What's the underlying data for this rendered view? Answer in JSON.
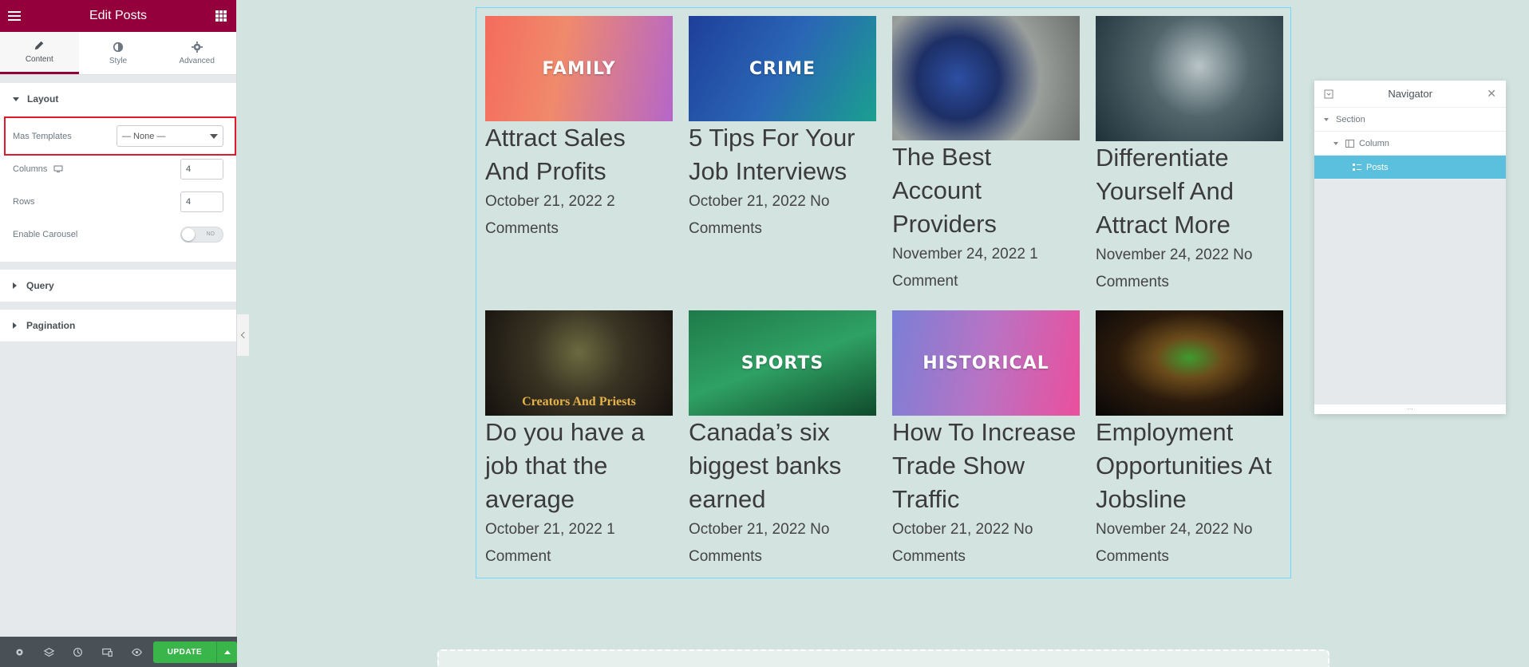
{
  "editor": {
    "header_title": "Edit Posts",
    "tabs": [
      {
        "label": "Content",
        "icon": "pencil-icon"
      },
      {
        "label": "Style",
        "icon": "half-circle-icon"
      },
      {
        "label": "Advanced",
        "icon": "gear-icon"
      }
    ],
    "layout": {
      "title": "Layout",
      "mas_templates_label": "Mas Templates",
      "mas_templates_value": "— None —",
      "columns_label": "Columns",
      "columns_value": "4",
      "rows_label": "Rows",
      "rows_value": "4",
      "carousel_label": "Enable Carousel",
      "carousel_value": "NO"
    },
    "query_title": "Query",
    "pagination_title": "Pagination",
    "footer": {
      "update_label": "UPDATE",
      "icons": [
        "settings-icon",
        "layers-icon",
        "history-icon",
        "responsive-icon",
        "preview-icon"
      ]
    }
  },
  "posts": [
    {
      "title": "Attract Sales And Profits",
      "meta": "October 21, 2022 2 Comments",
      "badge": "FAMILY",
      "subtitle": ""
    },
    {
      "title": "5 Tips For Your Job Interviews",
      "meta": "October 21, 2022 No Comments",
      "badge": "CRIME",
      "subtitle": ""
    },
    {
      "title": "The Best Account Providers",
      "meta": "November 24, 2022 1 Comment",
      "badge": "",
      "subtitle": ""
    },
    {
      "title": "Differentiate Yourself And Attract More",
      "meta": "November 24, 2022 No Comments",
      "badge": "",
      "subtitle": ""
    },
    {
      "title": "Do you have a job that the average",
      "meta": "October 21, 2022 1 Comment",
      "badge": "",
      "subtitle": "Creators And Priests"
    },
    {
      "title": "Canada’s six biggest banks earned",
      "meta": "October 21, 2022 No Comments",
      "badge": "SPORTS",
      "subtitle": ""
    },
    {
      "title": "How To Increase Trade Show Traffic",
      "meta": "October 21, 2022 No Comments",
      "badge": "HISTORICAL",
      "subtitle": ""
    },
    {
      "title": "Employment Opportunities At Jobsline",
      "meta": "November 24, 2022 No Comments",
      "badge": "",
      "subtitle": ""
    }
  ],
  "navigator": {
    "title": "Navigator",
    "items": [
      "Section",
      "Column",
      "Posts"
    ],
    "footer": "..."
  },
  "colors": {
    "brand": "#93003c",
    "canvas": "#d3e3df",
    "selection": "#71d7f7",
    "update": "#39b54a"
  }
}
